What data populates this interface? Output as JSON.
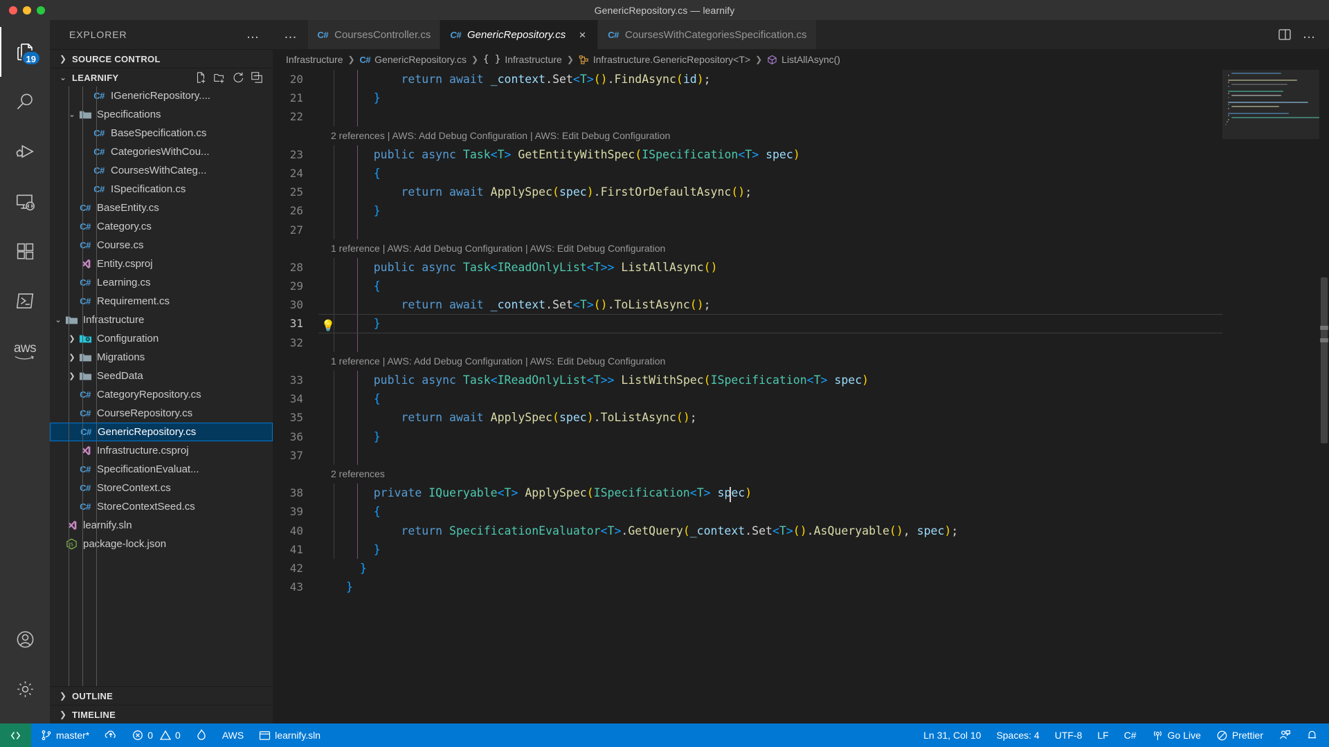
{
  "window": {
    "title": "GenericRepository.cs — learnify",
    "traffic_lights": [
      "close",
      "minimize",
      "zoom"
    ]
  },
  "activitybar": {
    "items": [
      {
        "name": "explorer",
        "icon": "files-icon",
        "badge": "19",
        "active": true
      },
      {
        "name": "search",
        "icon": "search-icon",
        "badge": null,
        "active": false
      },
      {
        "name": "run-and-debug",
        "icon": "debug-icon",
        "badge": null,
        "active": false
      },
      {
        "name": "remote-explorer",
        "icon": "remote-icon",
        "badge": null,
        "active": false
      },
      {
        "name": "extensions",
        "icon": "extensions-icon",
        "badge": null,
        "active": false
      },
      {
        "name": "terminal-powershell",
        "icon": "powershell-icon",
        "badge": null,
        "active": false
      },
      {
        "name": "aws-toolkit",
        "icon": "aws-icon",
        "label": "aws",
        "badge": null,
        "active": false
      }
    ],
    "bottom_items": [
      {
        "name": "accounts",
        "icon": "account-icon"
      },
      {
        "name": "manage",
        "icon": "gear-icon"
      }
    ]
  },
  "sidebar": {
    "title": "EXPLORER",
    "more_actions": "…",
    "sections": [
      {
        "name": "source-control",
        "label": "SOURCE CONTROL",
        "expanded": false
      },
      {
        "name": "learnify",
        "label": "LEARNIFY",
        "expanded": true
      },
      {
        "name": "outline",
        "label": "OUTLINE",
        "expanded": false
      },
      {
        "name": "timeline",
        "label": "TIMELINE",
        "expanded": false
      }
    ],
    "toolbar_icons": [
      "new-file-icon",
      "new-folder-icon",
      "refresh-icon",
      "collapse-all-icon"
    ],
    "tree": [
      {
        "label": "IGenericRepository....",
        "icon": "csharp-icon",
        "indent": 3,
        "twisty": "",
        "clipped": true
      },
      {
        "label": "Specifications",
        "icon": "folder-open-icon",
        "indent": 2,
        "twisty": "down"
      },
      {
        "label": "BaseSpecification.cs",
        "icon": "csharp-icon",
        "indent": 3,
        "twisty": ""
      },
      {
        "label": "CategoriesWithCou...",
        "icon": "csharp-icon",
        "indent": 3,
        "twisty": ""
      },
      {
        "label": "CoursesWithCateg...",
        "icon": "csharp-icon",
        "indent": 3,
        "twisty": ""
      },
      {
        "label": "ISpecification.cs",
        "icon": "csharp-icon",
        "indent": 3,
        "twisty": ""
      },
      {
        "label": "BaseEntity.cs",
        "icon": "csharp-icon",
        "indent": 2,
        "twisty": ""
      },
      {
        "label": "Category.cs",
        "icon": "csharp-icon",
        "indent": 2,
        "twisty": ""
      },
      {
        "label": "Course.cs",
        "icon": "csharp-icon",
        "indent": 2,
        "twisty": ""
      },
      {
        "label": "Entity.csproj",
        "icon": "visualstudio-icon",
        "indent": 2,
        "twisty": ""
      },
      {
        "label": "Learning.cs",
        "icon": "csharp-icon",
        "indent": 2,
        "twisty": ""
      },
      {
        "label": "Requirement.cs",
        "icon": "csharp-icon",
        "indent": 2,
        "twisty": ""
      },
      {
        "label": "Infrastructure",
        "icon": "folder-open-icon",
        "indent": 1,
        "twisty": "down"
      },
      {
        "label": "Configuration",
        "icon": "folder-config-icon",
        "indent": 2,
        "twisty": "right"
      },
      {
        "label": "Migrations",
        "icon": "folder-icon",
        "indent": 2,
        "twisty": "right"
      },
      {
        "label": "SeedData",
        "icon": "folder-icon",
        "indent": 2,
        "twisty": "right"
      },
      {
        "label": "CategoryRepository.cs",
        "icon": "csharp-icon",
        "indent": 2,
        "twisty": ""
      },
      {
        "label": "CourseRepository.cs",
        "icon": "csharp-icon",
        "indent": 2,
        "twisty": ""
      },
      {
        "label": "GenericRepository.cs",
        "icon": "csharp-icon",
        "indent": 2,
        "twisty": "",
        "selected": true
      },
      {
        "label": "Infrastructure.csproj",
        "icon": "visualstudio-icon",
        "indent": 2,
        "twisty": ""
      },
      {
        "label": "SpecificationEvaluat...",
        "icon": "csharp-icon",
        "indent": 2,
        "twisty": ""
      },
      {
        "label": "StoreContext.cs",
        "icon": "csharp-icon",
        "indent": 2,
        "twisty": ""
      },
      {
        "label": "StoreContextSeed.cs",
        "icon": "csharp-icon",
        "indent": 2,
        "twisty": ""
      },
      {
        "label": "learnify.sln",
        "icon": "visualstudio-icon",
        "indent": 1,
        "twisty": ""
      },
      {
        "label": "package-lock.json",
        "icon": "nodejs-icon",
        "indent": 1,
        "twisty": ""
      }
    ]
  },
  "tabs": {
    "overflow_icon": "…",
    "items": [
      {
        "label": "CoursesController.cs",
        "icon": "csharp-icon",
        "active": false,
        "dirty": false
      },
      {
        "label": "GenericRepository.cs",
        "icon": "csharp-icon",
        "active": true,
        "dirty": false,
        "close": "×"
      },
      {
        "label": "CoursesWithCategoriesSpecification.cs",
        "icon": "csharp-icon",
        "active": false,
        "dirty": false
      }
    ],
    "right_actions": [
      "split-editor-icon",
      "more-actions-icon"
    ]
  },
  "breadcrumbs": [
    {
      "label": "Infrastructure",
      "icon": null
    },
    {
      "label": "GenericRepository.cs",
      "icon": "csharp-icon"
    },
    {
      "label": "Infrastructure",
      "icon": "namespace-icon"
    },
    {
      "label": "Infrastructure.GenericRepository<T>",
      "icon": "class-icon"
    },
    {
      "label": "ListAllAsync()",
      "icon": "method-icon"
    }
  ],
  "editor": {
    "first_visible_line": 20,
    "cursor_line": 31,
    "lightbulb_line": 31,
    "codelens": {
      "two_refs": "2 references | AWS: Add Debug Configuration | AWS: Edit Debug Configuration",
      "one_ref": "1 reference | AWS: Add Debug Configuration | AWS: Edit Debug Configuration",
      "two_refs_plain": "2 references"
    },
    "lines": [
      {
        "n": 20,
        "text": "        return await _context.Set<T>().FindAsync(id);"
      },
      {
        "n": 21,
        "text": "    }"
      },
      {
        "n": 22,
        "text": ""
      },
      {
        "n": 23,
        "text": "    public async Task<T> GetEntityWithSpec(ISpecification<T> spec)"
      },
      {
        "n": 24,
        "text": "    {"
      },
      {
        "n": 25,
        "text": "        return await ApplySpec(spec).FirstOrDefaultAsync();"
      },
      {
        "n": 26,
        "text": "    }"
      },
      {
        "n": 27,
        "text": ""
      },
      {
        "n": 28,
        "text": "    public async Task<IReadOnlyList<T>> ListAllAsync()"
      },
      {
        "n": 29,
        "text": "    {"
      },
      {
        "n": 30,
        "text": "        return await _context.Set<T>().ToListAsync();"
      },
      {
        "n": 31,
        "text": "    }"
      },
      {
        "n": 32,
        "text": ""
      },
      {
        "n": 33,
        "text": "    public async Task<IReadOnlyList<T>> ListWithSpec(ISpecification<T> spec)"
      },
      {
        "n": 34,
        "text": "    {"
      },
      {
        "n": 35,
        "text": "        return await ApplySpec(spec).ToListAsync();"
      },
      {
        "n": 36,
        "text": "    }"
      },
      {
        "n": 37,
        "text": ""
      },
      {
        "n": 38,
        "text": "    private IQueryable<T> ApplySpec(ISpecification<T> spec)"
      },
      {
        "n": 39,
        "text": "    {"
      },
      {
        "n": 40,
        "text": "        return SpecificationEvaluator<T>.GetQuery(_context.Set<T>().AsQueryable(), spec);"
      },
      {
        "n": 41,
        "text": "    }"
      },
      {
        "n": 42,
        "text": "  }"
      },
      {
        "n": 43,
        "text": "}"
      }
    ]
  },
  "statusbar": {
    "remote_icon": "remote-window-icon",
    "left": [
      {
        "name": "branch",
        "icon": "source-control-icon",
        "label": "master*"
      },
      {
        "name": "sync",
        "icon": "sync-icon",
        "label": ""
      },
      {
        "name": "problems",
        "icon": "errors-warnings-icon",
        "label": "0  0",
        "errors": "0",
        "warnings": "0"
      },
      {
        "name": "radon",
        "icon": "flame-icon",
        "label": ""
      },
      {
        "name": "aws",
        "icon": null,
        "label": "AWS"
      },
      {
        "name": "solution",
        "icon": "window-icon",
        "label": "learnify.sln"
      }
    ],
    "right": [
      {
        "name": "cursor-position",
        "label": "Ln 31, Col 10"
      },
      {
        "name": "indentation",
        "label": "Spaces: 4"
      },
      {
        "name": "encoding",
        "label": "UTF-8"
      },
      {
        "name": "eol",
        "label": "LF"
      },
      {
        "name": "language-mode",
        "label": "C#"
      },
      {
        "name": "go-live",
        "icon": "broadcast-icon",
        "label": "Go Live"
      },
      {
        "name": "prettier",
        "icon": "prettier-icon",
        "label": "Prettier"
      },
      {
        "name": "feedback",
        "icon": "feedback-icon",
        "label": ""
      },
      {
        "name": "notifications",
        "icon": "bell-icon",
        "label": ""
      }
    ]
  },
  "colors": {
    "accent": "#0078d4",
    "remote_green": "#16825d",
    "selection": "#04395e",
    "editor_bg": "#1e1e1e",
    "sidebar_bg": "#252526",
    "activitybar_bg": "#333333",
    "titlebar_bg": "#323233"
  }
}
